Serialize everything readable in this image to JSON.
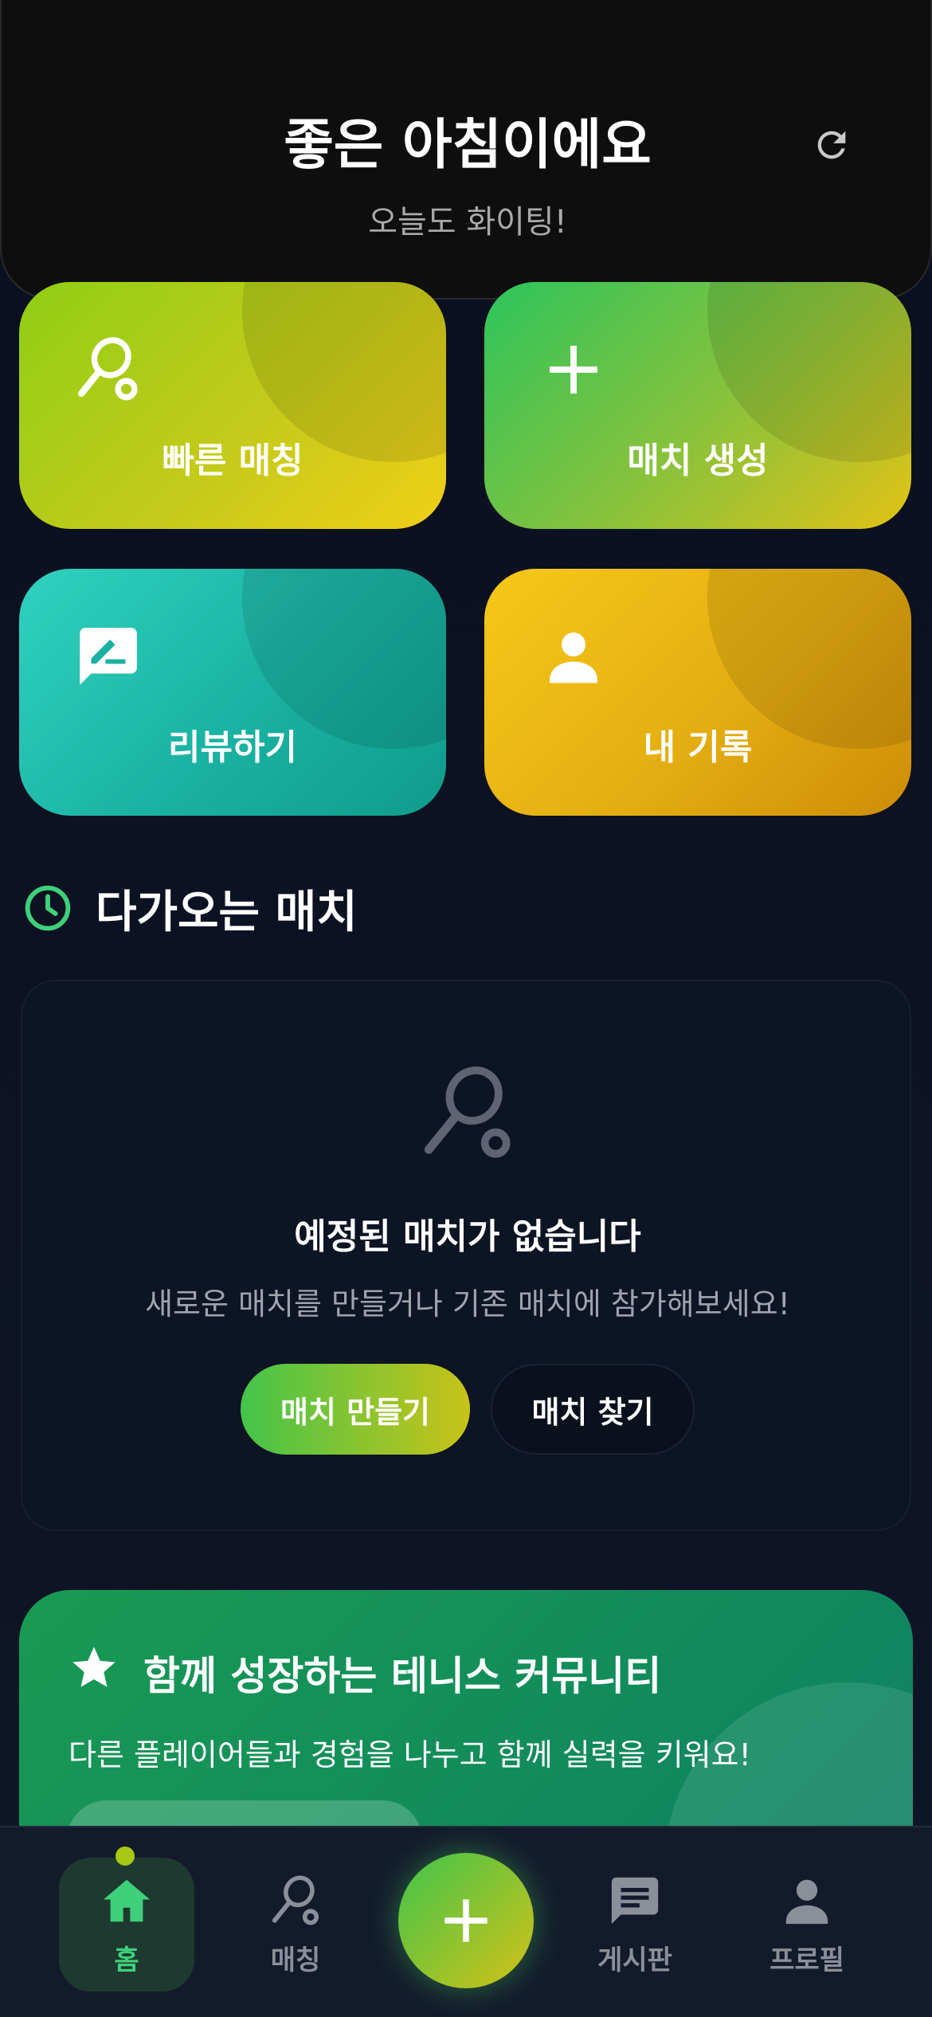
{
  "header": {
    "title": "좋은 아침이에요",
    "subtitle": "오늘도 화이팅!",
    "refresh_icon": "refresh-icon"
  },
  "quick_actions": [
    {
      "label": "빠른 매칭",
      "icon": "tennis-racket-icon"
    },
    {
      "label": "매치 생성",
      "icon": "plus-icon"
    },
    {
      "label": "리뷰하기",
      "icon": "edit-comment-icon"
    },
    {
      "label": "내 기록",
      "icon": "person-icon"
    }
  ],
  "upcoming": {
    "heading": "다가오는 매치",
    "heading_icon": "clock-icon",
    "empty_icon": "tennis-racket-icon",
    "empty_title": "예정된 매치가 없습니다",
    "empty_desc": "새로운 매치를 만들거나 기존 매치에 참가해보세요!",
    "create_button": "매치 만들기",
    "find_button": "매치 찾기"
  },
  "community": {
    "title": "함께 성장하는 테니스 커뮤니티",
    "description": "다른 플레이어들과 경험을 나누고 함께 실력을 키워요!",
    "icon": "star-icon"
  },
  "bottom_nav": {
    "items": [
      {
        "label": "홈",
        "icon": "home-icon",
        "active": true
      },
      {
        "label": "매칭",
        "icon": "tennis-racket-icon",
        "active": false
      },
      {
        "label": "게시판",
        "icon": "chat-icon",
        "active": false
      },
      {
        "label": "프로필",
        "icon": "person-icon",
        "active": false
      }
    ],
    "fab_icon": "plus-icon"
  },
  "colors": {
    "accent_green": "#3ed07a",
    "accent_yellow": "#f0cf18",
    "background": "#0a0f1e"
  }
}
